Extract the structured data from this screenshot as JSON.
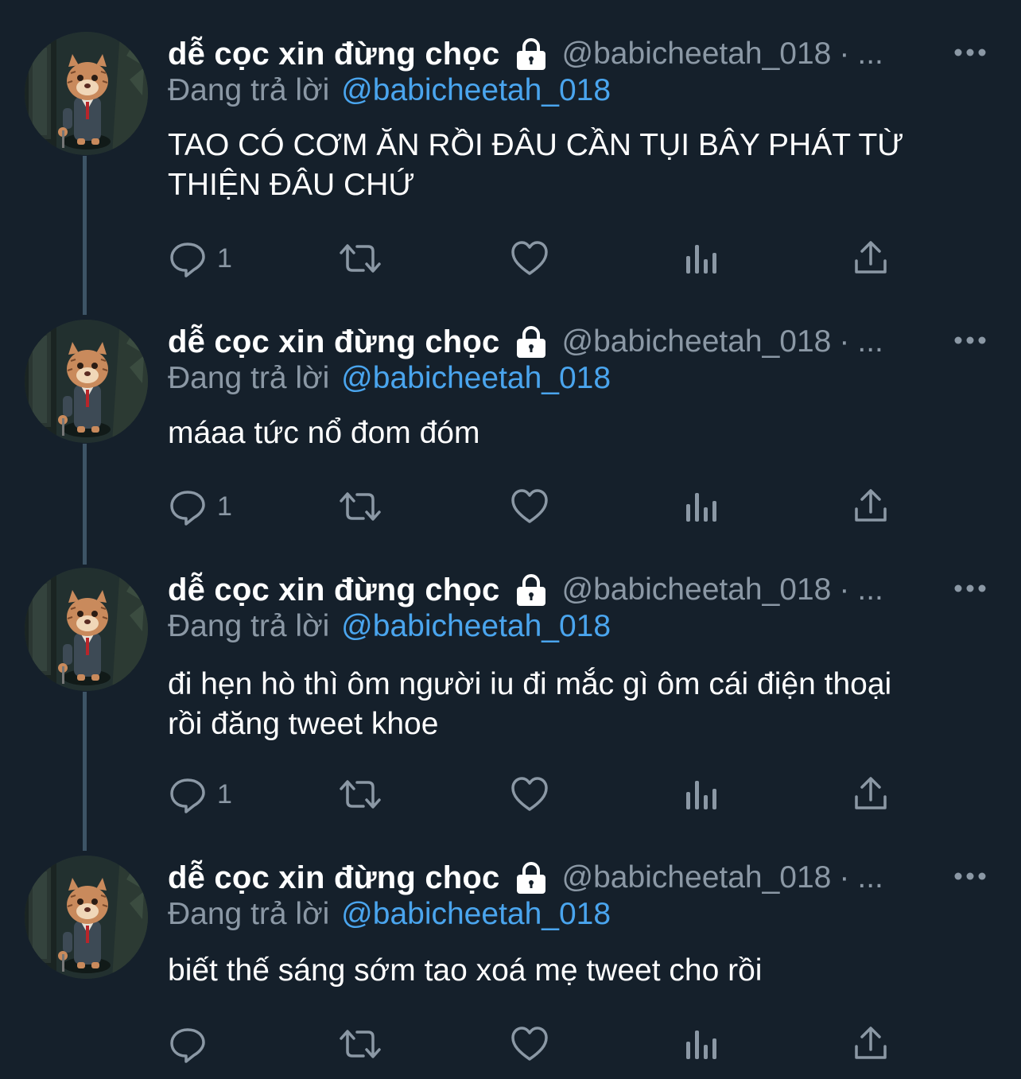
{
  "colors": {
    "background": "#15202b",
    "text_primary": "#ffffff",
    "text_secondary": "#8b98a5",
    "accent": "#4aa5ee",
    "thread_line": "#3d5466"
  },
  "icons": {
    "lock": "lock-icon",
    "more": "more-icon",
    "reply": "reply-icon",
    "retweet": "retweet-icon",
    "like": "heart-icon",
    "analytics": "analytics-icon",
    "share": "share-icon"
  },
  "tweets": [
    {
      "display_name": "dễ cọc xin đừng chọc",
      "handle": "@babicheetah_018",
      "dot": "·",
      "ellipsis": "...",
      "reply_prefix": "Đang trả lời",
      "reply_to": "@babicheetah_018",
      "text_lines": [
        "TAO CÓ CƠM ĂN RỒI ĐÂU CẦN TỤI BÂY PHÁT TỪ",
        "THIỆN ĐÂU CHỨ"
      ],
      "reply_count": "1"
    },
    {
      "display_name": "dễ cọc xin đừng chọc",
      "handle": "@babicheetah_018",
      "dot": "·",
      "ellipsis": "...",
      "reply_prefix": "Đang trả lời",
      "reply_to": "@babicheetah_018",
      "text_lines": [
        "máaa tức nổ đom đóm"
      ],
      "reply_count": "1"
    },
    {
      "display_name": "dễ cọc xin đừng chọc",
      "handle": "@babicheetah_018",
      "dot": "·",
      "ellipsis": "...",
      "reply_prefix": "Đang trả lời",
      "reply_to": "@babicheetah_018",
      "text_lines": [
        "đi hẹn hò thì ôm người iu đi mắc gì ôm cái điện thoại",
        "rồi đăng tweet khoe"
      ],
      "reply_count": "1"
    },
    {
      "display_name": "dễ cọc xin đừng chọc",
      "handle": "@babicheetah_018",
      "dot": "·",
      "ellipsis": "...",
      "reply_prefix": "Đang trả lời",
      "reply_to": "@babicheetah_018",
      "text_lines": [
        "biết thế sáng sớm tao xoá mẹ tweet cho rồi"
      ],
      "reply_count": ""
    }
  ]
}
